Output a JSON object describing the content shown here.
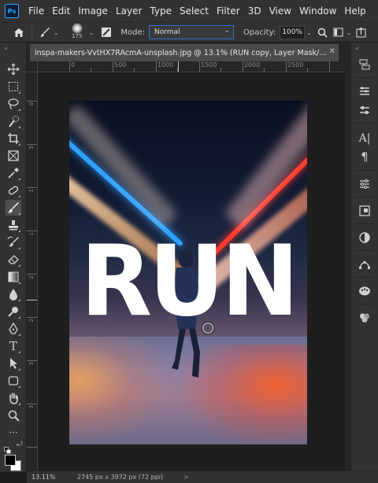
{
  "app": {
    "logo_text": "Ps"
  },
  "menu": [
    "File",
    "Edit",
    "Image",
    "Layer",
    "Type",
    "Select",
    "Filter",
    "3D",
    "View",
    "Window",
    "Help"
  ],
  "options_bar": {
    "brush_size": "175",
    "mode_label": "Mode:",
    "mode_value": "Normal",
    "opacity_label": "Opacity:",
    "opacity_value": "100%"
  },
  "document": {
    "tab_title": "inspa-makers-VvtHX7RAcmA-unsplash.jpg @ 13.1% (RUN copy, Layer Mask/...",
    "canvas_text": "RUN"
  },
  "ruler": {
    "top_labels": [
      "0",
      "500",
      "1000",
      "1500",
      "2000",
      "2500"
    ],
    "left_labels": [
      "0",
      "5",
      "1",
      "1",
      "2",
      "2",
      "3",
      "3"
    ]
  },
  "status": {
    "zoom": "13.11%",
    "doc_info": "2745 px x 3972 px (72 ppi)",
    "arrow": ">"
  },
  "colors": {
    "foreground": "#000000",
    "background": "#ffffff",
    "accent": "#2f6fd8"
  }
}
